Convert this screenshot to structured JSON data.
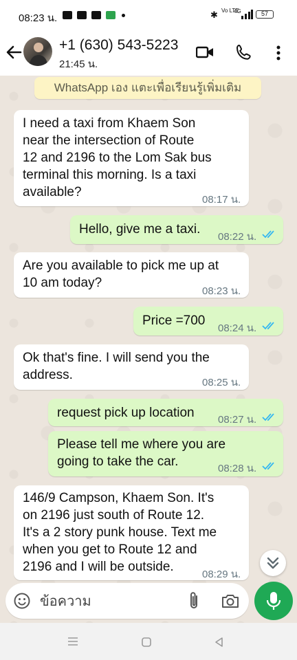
{
  "status_bar": {
    "time": "08:23 น.",
    "volte": "Vo LTE",
    "network": "4G",
    "battery": "57"
  },
  "header": {
    "contact_name": "+1 (630) 543-5223",
    "contact_status": "21:45 น."
  },
  "info_banner": "WhatsApp เอง แตะเพื่อเรียนรู้เพิ่มเติม",
  "messages": [
    {
      "direction": "in",
      "lines": [
        "I need a taxi from Khaem Son",
        "near the intersection of Route",
        "12 and 2196 to the Lom Sak bus",
        "terminal this morning. Is a taxi",
        "available?"
      ],
      "time": "08:17 น."
    },
    {
      "direction": "out",
      "lines": [
        "Hello, give me a taxi."
      ],
      "time": "08:22 น.",
      "read": true
    },
    {
      "direction": "in",
      "lines": [
        "Are you available to pick me up at",
        "10 am today?"
      ],
      "time": "08:23 น."
    },
    {
      "direction": "out",
      "lines": [
        "Price =700"
      ],
      "time": "08:24 น.",
      "read": true
    },
    {
      "direction": "in",
      "lines": [
        "Ok that's fine. I will send you the",
        "address."
      ],
      "time": "08:25 น."
    },
    {
      "direction": "out",
      "lines": [
        "request pick up location"
      ],
      "time": "08:27 น.",
      "read": true
    },
    {
      "direction": "out",
      "lines": [
        "Please tell me where you are",
        "going to take the car."
      ],
      "time": "08:28 น.",
      "read": true
    },
    {
      "direction": "in",
      "lines": [
        "146/9 Campson, Khaem Son. It's",
        "on 2196 just south of Route 12.",
        "It's a 2 story punk house. Text me",
        "when you get to Route 12 and",
        "2196 and I will be outside."
      ],
      "time": "08:29 น."
    }
  ],
  "composer": {
    "placeholder": "ข้อความ"
  },
  "colors": {
    "incoming_bubble": "#ffffff",
    "outgoing_bubble": "#dcf8c6",
    "read_ticks": "#34b7f1",
    "accent_green": "#1fa955",
    "chat_background": "#ece5dd"
  },
  "icons": [
    "back-arrow-icon",
    "video-call-icon",
    "phone-call-icon",
    "more-vert-icon",
    "emoji-icon",
    "attach-icon",
    "camera-icon",
    "mic-icon",
    "chevron-double-down-icon"
  ]
}
